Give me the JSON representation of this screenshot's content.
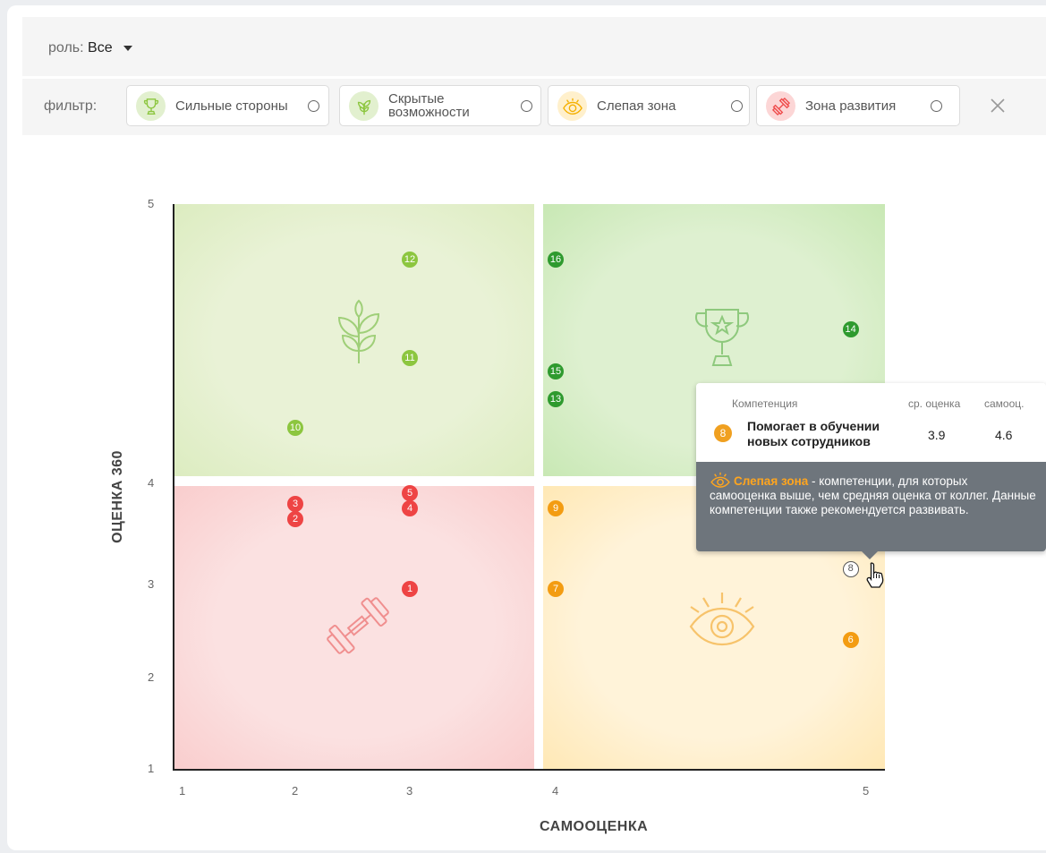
{
  "role": {
    "label": "роль:",
    "value": "Все"
  },
  "filter": {
    "label": "фильтр:",
    "chips": [
      {
        "label": "Сильные стороны",
        "icon": "trophy-icon",
        "color": "#8cc63f"
      },
      {
        "label": "Скрытые возможности",
        "icon": "leaf-icon",
        "color": "#8cc63f"
      },
      {
        "label": "Слепая зона",
        "icon": "eye-icon",
        "color": "#f5b000"
      },
      {
        "label": "Зона развития",
        "icon": "dumbbell-icon",
        "color": "#ef4b4b"
      }
    ],
    "close_icon": "close-icon"
  },
  "colors": {
    "green_light": "#8cc63f",
    "green_dark": "#2e9a2e",
    "red": "#ee4444",
    "orange": "#f39c12",
    "tooltip_bg": "#6e757c"
  },
  "chart_data": {
    "type": "scatter",
    "xlabel": "САМООЦЕНКА",
    "ylabel": "ОЦЕНКА 360",
    "x_ticks": [
      "1",
      "2",
      "3",
      "4",
      "5"
    ],
    "y_ticks": [
      "1",
      "2",
      "3",
      "4",
      "5"
    ],
    "xlim": [
      1,
      5
    ],
    "ylim": [
      1,
      5
    ],
    "points": [
      {
        "id": "1",
        "x": 3.0,
        "y": 2.95,
        "zone": "development"
      },
      {
        "id": "2",
        "x": 2.0,
        "y": 3.65,
        "zone": "development"
      },
      {
        "id": "3",
        "x": 2.0,
        "y": 3.8,
        "zone": "development"
      },
      {
        "id": "4",
        "x": 3.0,
        "y": 3.75,
        "zone": "development"
      },
      {
        "id": "5",
        "x": 3.0,
        "y": 3.9,
        "zone": "development"
      },
      {
        "id": "6",
        "x": 4.95,
        "y": 2.4,
        "zone": "blind"
      },
      {
        "id": "7",
        "x": 4.0,
        "y": 2.95,
        "zone": "blind"
      },
      {
        "id": "8",
        "x": 4.95,
        "y": 3.15,
        "zone": "blind",
        "selected": true
      },
      {
        "id": "9",
        "x": 4.0,
        "y": 3.75,
        "zone": "blind"
      },
      {
        "id": "10",
        "x": 2.0,
        "y": 4.2,
        "zone": "hidden"
      },
      {
        "id": "11",
        "x": 3.0,
        "y": 4.45,
        "zone": "hidden"
      },
      {
        "id": "12",
        "x": 3.0,
        "y": 4.8,
        "zone": "hidden"
      },
      {
        "id": "13",
        "x": 4.0,
        "y": 4.3,
        "zone": "strength"
      },
      {
        "id": "14",
        "x": 4.95,
        "y": 4.55,
        "zone": "strength"
      },
      {
        "id": "15",
        "x": 4.0,
        "y": 4.4,
        "zone": "strength"
      },
      {
        "id": "16",
        "x": 4.0,
        "y": 4.8,
        "zone": "strength"
      }
    ]
  },
  "tooltip": {
    "col_competence": "Компетенция",
    "col_avg": "ср. оценка",
    "col_self": "самооц.",
    "number": "8",
    "competence": "Помогает в обучении новых сотрудников",
    "avg": "3.9",
    "self": "4.6",
    "zone_name": "Слепая зона",
    "zone_desc": " - компетенции, для которых самооценка выше, чем средняя оценка от коллег. Данные компетенции также рекомендуется развивать."
  }
}
